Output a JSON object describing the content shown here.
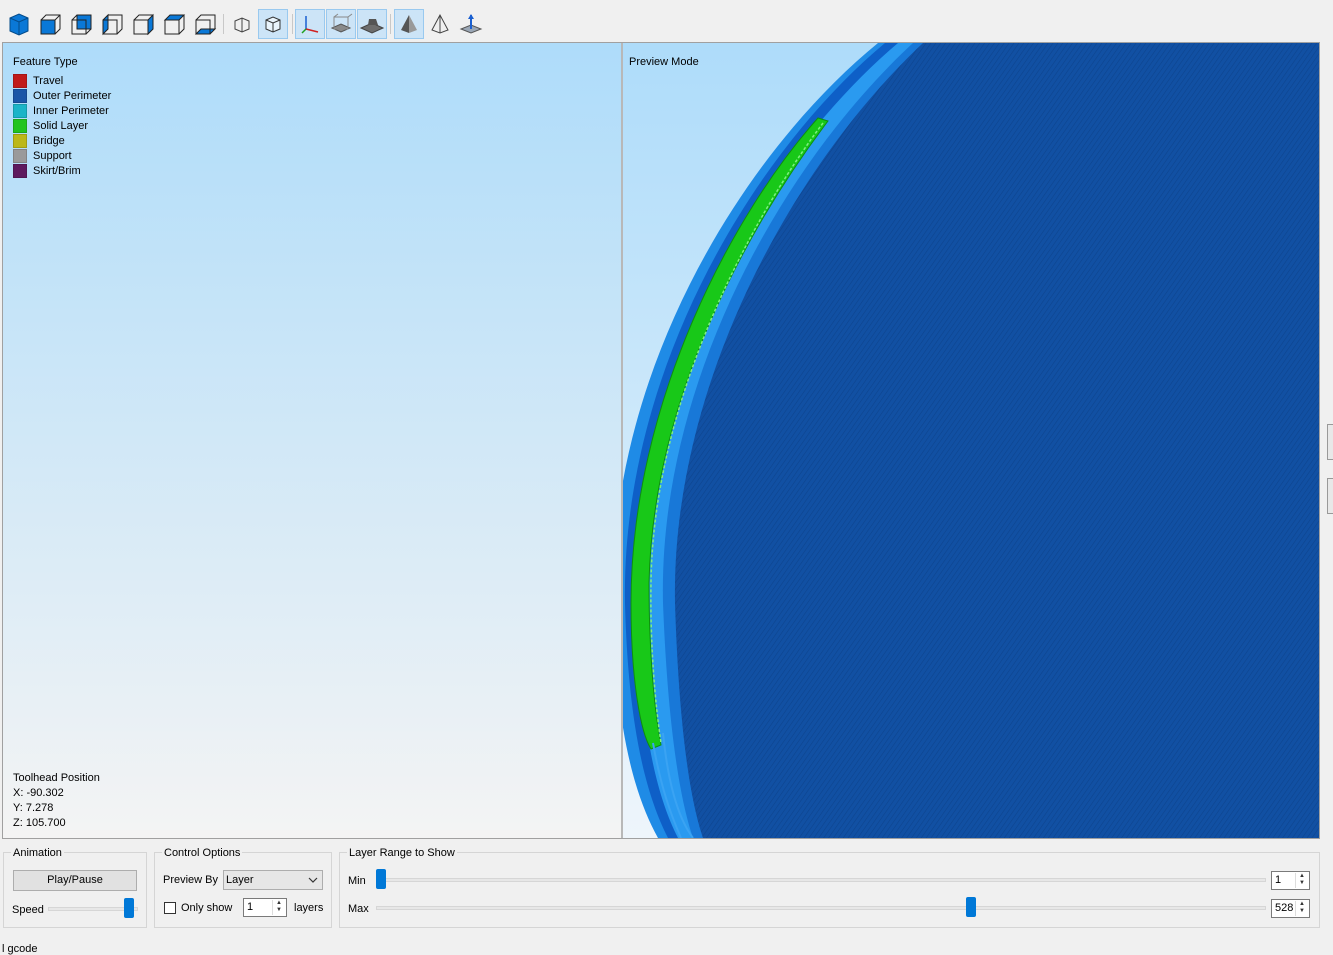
{
  "toolbar": {
    "buttons": [
      {
        "icon": "iso-view-icon"
      },
      {
        "icon": "view-front-icon"
      },
      {
        "icon": "view-back-icon"
      },
      {
        "icon": "view-left-icon"
      },
      {
        "icon": "view-right-icon"
      },
      {
        "icon": "view-top-icon"
      },
      {
        "icon": "view-bottom-icon"
      },
      {
        "icon": "orthographic-icon"
      },
      {
        "icon": "perspective-icon"
      },
      {
        "icon": "axes-icon"
      },
      {
        "icon": "build-volume-icon"
      },
      {
        "icon": "bed-icon"
      },
      {
        "icon": "solid-shading-icon"
      },
      {
        "icon": "wireframe-shading-icon"
      },
      {
        "icon": "cut-plane-icon"
      }
    ]
  },
  "legend": {
    "title": "Feature Type",
    "items": [
      {
        "label": "Travel",
        "color": "#c01a1a"
      },
      {
        "label": "Outer Perimeter",
        "color": "#1a56a8"
      },
      {
        "label": "Inner Perimeter",
        "color": "#1bb5c8"
      },
      {
        "label": "Solid Layer",
        "color": "#21c421"
      },
      {
        "label": "Bridge",
        "color": "#bcb81a"
      },
      {
        "label": "Support",
        "color": "#9a9a9a"
      },
      {
        "label": "Skirt/Brim",
        "color": "#5e1a5e"
      }
    ]
  },
  "toolhead": {
    "title": "Toolhead Position",
    "x": "X: -90.302",
    "y": "Y: 7.278",
    "z": "Z: 105.700"
  },
  "right_view": {
    "mode_label": "Preview Mode"
  },
  "animation": {
    "title": "Animation",
    "play_label": "Play/Pause",
    "speed_label": "Speed",
    "speed_fraction": 0.95
  },
  "control_options": {
    "title": "Control Options",
    "preview_by_label": "Preview By",
    "preview_by_value": "Layer",
    "only_show_label": "Only show",
    "only_show_checked": false,
    "layers_value": "1",
    "layers_label": "layers"
  },
  "layer_range": {
    "title": "Layer Range to Show",
    "min_label": "Min",
    "max_label": "Max",
    "min_value": "1",
    "max_value": "528",
    "min_fraction": 0.0,
    "max_fraction": 0.67
  },
  "status": {
    "text": "l gcode"
  }
}
